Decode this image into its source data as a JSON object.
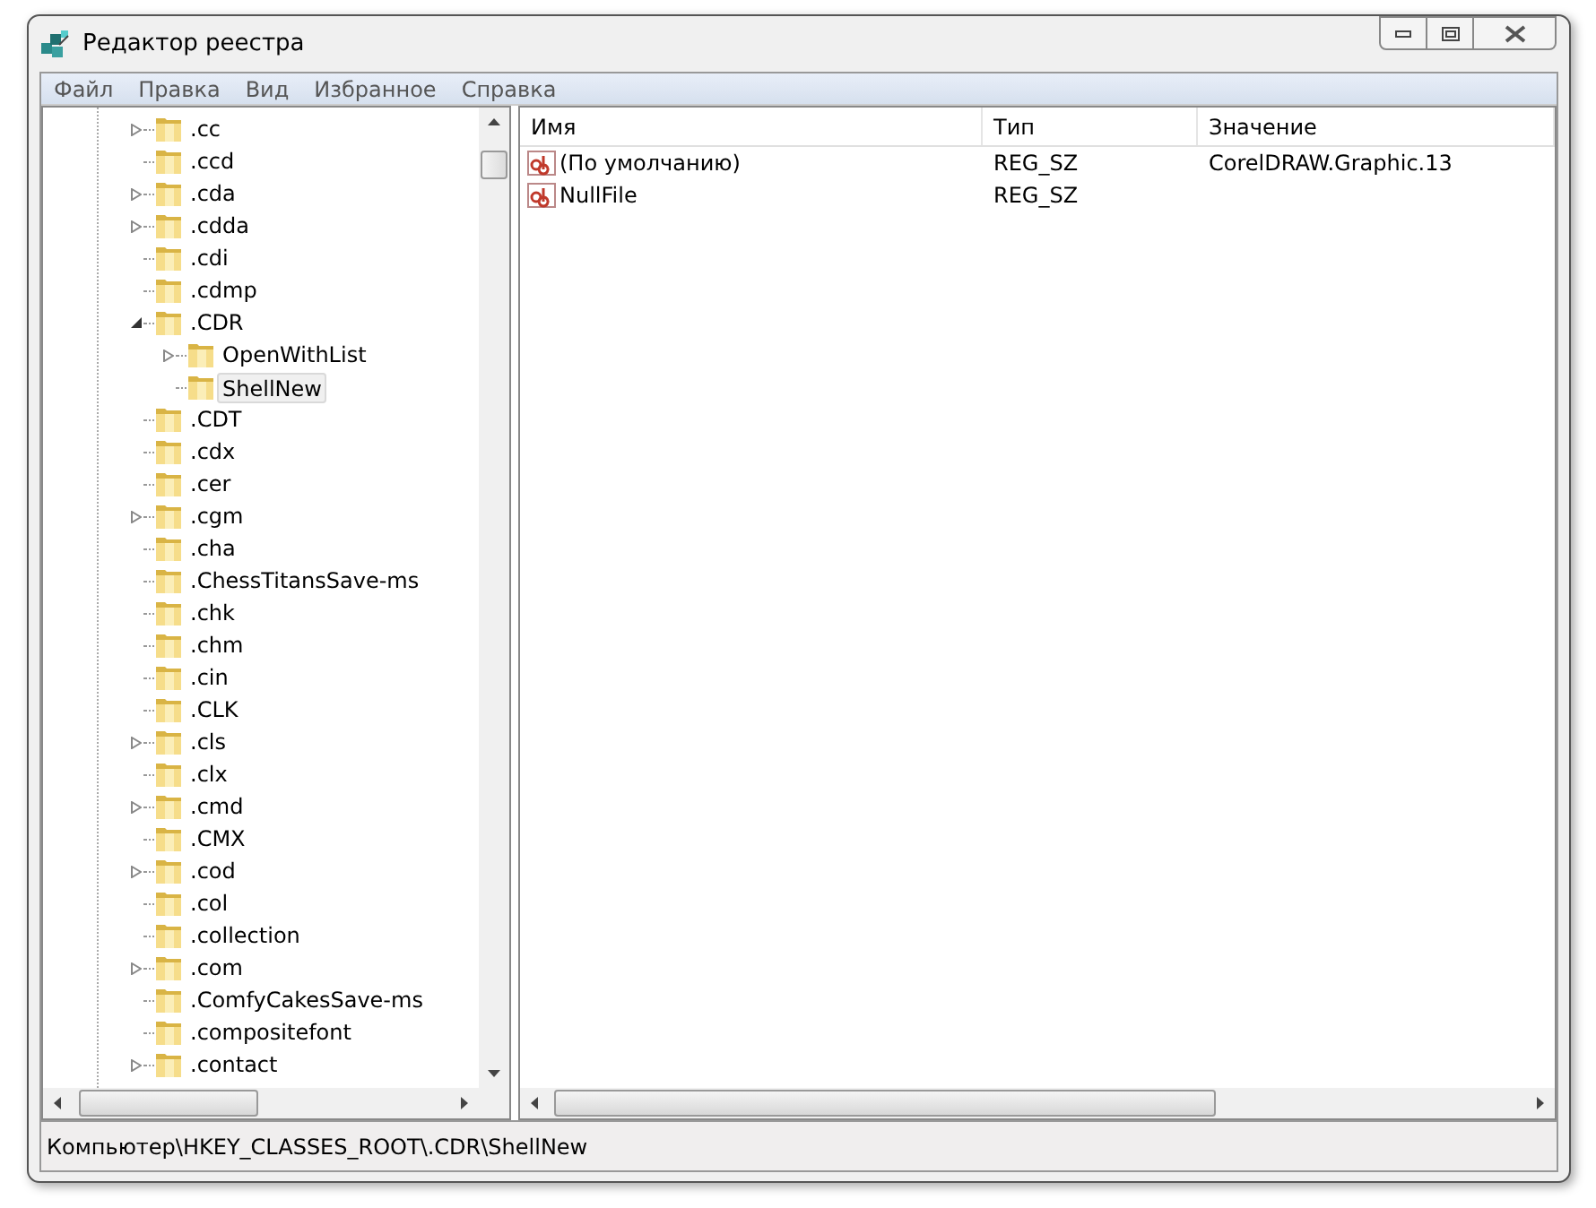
{
  "window": {
    "title": "Редактор реестра"
  },
  "menu": [
    "Файл",
    "Правка",
    "Вид",
    "Избранное",
    "Справка"
  ],
  "tree": [
    {
      "label": ".cc",
      "expanded": false,
      "selected": false
    },
    {
      "label": ".ccd",
      "selected": false
    },
    {
      "label": ".cda",
      "expanded": false,
      "selected": false
    },
    {
      "label": ".cdda",
      "expanded": false,
      "selected": false
    },
    {
      "label": ".cdi",
      "selected": false
    },
    {
      "label": ".cdmp",
      "selected": false
    },
    {
      "label": ".CDR",
      "expanded": true,
      "selected": false,
      "children": [
        {
          "label": "OpenWithList",
          "expanded": false,
          "selected": false
        },
        {
          "label": "ShellNew",
          "selected": true
        }
      ]
    },
    {
      "label": ".CDT",
      "selected": false
    },
    {
      "label": ".cdx",
      "selected": false
    },
    {
      "label": ".cer",
      "selected": false
    },
    {
      "label": ".cgm",
      "expanded": false,
      "selected": false
    },
    {
      "label": ".cha",
      "selected": false
    },
    {
      "label": ".ChessTitansSave-ms",
      "selected": false
    },
    {
      "label": ".chk",
      "selected": false
    },
    {
      "label": ".chm",
      "selected": false
    },
    {
      "label": ".cin",
      "selected": false
    },
    {
      "label": ".CLK",
      "selected": false
    },
    {
      "label": ".cls",
      "expanded": false,
      "selected": false
    },
    {
      "label": ".clx",
      "selected": false
    },
    {
      "label": ".cmd",
      "expanded": false,
      "selected": false
    },
    {
      "label": ".CMX",
      "selected": false
    },
    {
      "label": ".cod",
      "expanded": false,
      "selected": false
    },
    {
      "label": ".col",
      "selected": false
    },
    {
      "label": ".collection",
      "selected": false
    },
    {
      "label": ".com",
      "expanded": false,
      "selected": false
    },
    {
      "label": ".ComfyCakesSave-ms",
      "selected": false
    },
    {
      "label": ".compositefont",
      "selected": false
    },
    {
      "label": ".contact",
      "expanded": false,
      "selected": false
    }
  ],
  "values": {
    "columns": [
      "Имя",
      "Тип",
      "Значение"
    ],
    "rows": [
      {
        "name": "(По умолчанию)",
        "type": "REG_SZ",
        "data": "CorelDRAW.Graphic.13"
      },
      {
        "name": "NullFile",
        "type": "REG_SZ"
      }
    ]
  },
  "status_bar": "Компьютер\\HKEY_CLASSES_ROOT\\.CDR\\ShellNew"
}
